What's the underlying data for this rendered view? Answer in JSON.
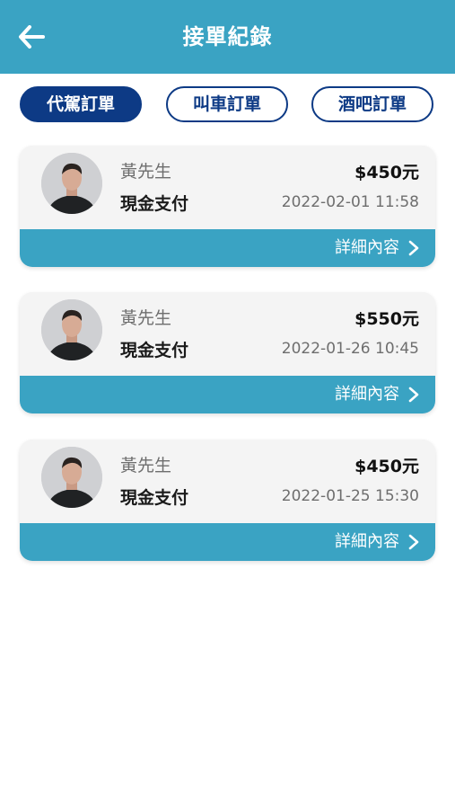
{
  "header": {
    "title": "接單紀錄",
    "back_icon": "arrow-left-icon"
  },
  "tabs": [
    {
      "label": "代駕訂單",
      "active": true
    },
    {
      "label": "叫車訂單",
      "active": false
    },
    {
      "label": "酒吧訂單",
      "active": false
    }
  ],
  "orders": [
    {
      "name": "黃先生",
      "payment": "現金支付",
      "amount": "$450元",
      "datetime": "2022-02-01 11:58",
      "detail_label": "詳細內容"
    },
    {
      "name": "黃先生",
      "payment": "現金支付",
      "amount": "$550元",
      "datetime": "2022-01-26 10:45",
      "detail_label": "詳細內容"
    },
    {
      "name": "黃先生",
      "payment": "現金支付",
      "amount": "$450元",
      "datetime": "2022-01-25 15:30",
      "detail_label": "詳細內容"
    }
  ],
  "colors": {
    "header": "#3aa3c3",
    "tab_active": "#0d3a85",
    "card_bg": "#f4f4f4"
  }
}
